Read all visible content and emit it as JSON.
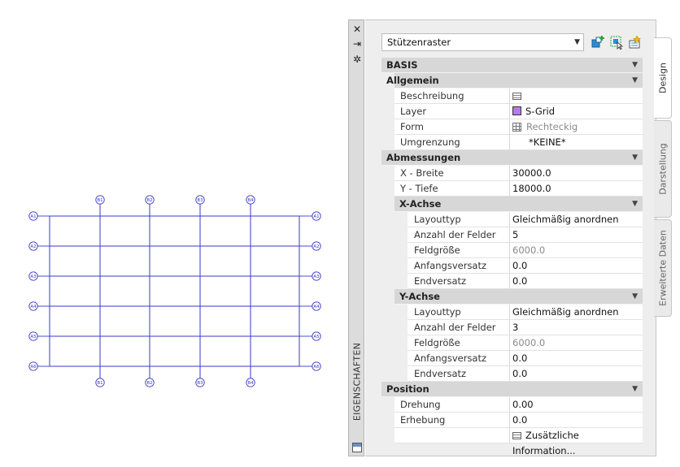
{
  "drawing": {
    "columns_top": [
      "B1",
      "B2",
      "B3",
      "B4"
    ],
    "columns_bottom": [
      "B1",
      "B2",
      "B3",
      "B4"
    ],
    "rows_left": [
      "A1",
      "A2",
      "A3",
      "A4",
      "A5",
      "A6"
    ],
    "rows_right": [
      "A1",
      "A2",
      "A3",
      "A4",
      "A5",
      "A6"
    ],
    "line_color": "#3a3ac8"
  },
  "palette": {
    "title": "EIGENSCHAFTEN",
    "close_icon": "close-icon",
    "autohide_icon": "autohide-icon",
    "settings_icon": "settings-icon",
    "style_select": {
      "value": "Stützenraster"
    },
    "tools": [
      "add-style-icon",
      "select-objects-icon",
      "quick-select-icon"
    ],
    "tabs": [
      "Design",
      "Darstellung",
      "Erweiterte Daten"
    ],
    "active_tab": "Design"
  },
  "properties": {
    "basis": "BASIS",
    "allgemein": {
      "label": "Allgemein",
      "beschreibung": "Beschreibung",
      "layer_label": "Layer",
      "layer_value": "S-Grid",
      "layer_color": "#b37bf0",
      "form_label": "Form",
      "form_value": "Rechteckig",
      "umgrenzung_label": "Umgrenzung",
      "umgrenzung_value": "*KEINE*"
    },
    "abmessungen": {
      "label": "Abmessungen",
      "x_breite_label": "X - Breite",
      "x_breite_value": "30000.0",
      "y_tiefe_label": "Y - Tiefe",
      "y_tiefe_value": "18000.0"
    },
    "x_achse": {
      "label": "X-Achse",
      "layouttyp_label": "Layouttyp",
      "layouttyp_value": "Gleichmäßig anordnen",
      "anzahl_label": "Anzahl der Felder",
      "anzahl_value": "5",
      "feldgroesse_label": "Feldgröße",
      "feldgroesse_value": "6000.0",
      "anfang_label": "Anfangsversatz",
      "anfang_value": "0.0",
      "end_label": "Endversatz",
      "end_value": "0.0"
    },
    "y_achse": {
      "label": "Y-Achse",
      "layouttyp_label": "Layouttyp",
      "layouttyp_value": "Gleichmäßig anordnen",
      "anzahl_label": "Anzahl der Felder",
      "anzahl_value": "3",
      "feldgroesse_label": "Feldgröße",
      "feldgroesse_value": "6000.0",
      "anfang_label": "Anfangsversatz",
      "anfang_value": "0.0",
      "end_label": "Endversatz",
      "end_value": "0.0"
    },
    "position": {
      "label": "Position",
      "drehung_label": "Drehung",
      "drehung_value": "0.00",
      "erhebung_label": "Erhebung",
      "erhebung_value": "0.0",
      "zusatz_label": "Zusätzliche Information..."
    }
  }
}
